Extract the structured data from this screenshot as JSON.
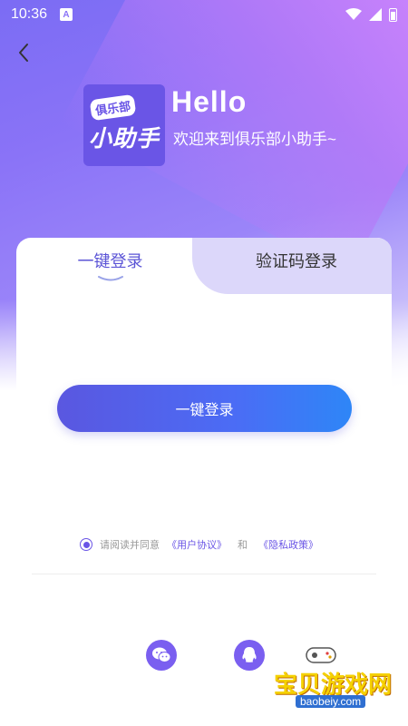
{
  "status_bar": {
    "time": "10:36",
    "a_badge": "A"
  },
  "header": {
    "back_icon": "chevron-left-icon",
    "logo_tag": "俱乐部",
    "logo_main": "小助手",
    "hello": "Hello",
    "welcome": "欢迎来到俱乐部小助手~"
  },
  "tabs": [
    {
      "label": "一键登录",
      "active": true
    },
    {
      "label": "验证码登录",
      "active": false
    }
  ],
  "main": {
    "onekey_button": "一键登录"
  },
  "agreement": {
    "prefix": "请阅读并同意",
    "user_agreement": "《用户协议》",
    "and": "和",
    "privacy_policy": "《隐私政策》",
    "checked": true
  },
  "social": [
    {
      "name": "wechat",
      "icon": "wechat-icon"
    },
    {
      "name": "qq",
      "icon": "qq-icon"
    }
  ],
  "watermark": {
    "text": "宝贝游戏网",
    "url": "baobeiy.com"
  },
  "colors": {
    "accent": "#6a55e6",
    "gradient_start": "#5a57e0",
    "gradient_end": "#2e86f7"
  }
}
